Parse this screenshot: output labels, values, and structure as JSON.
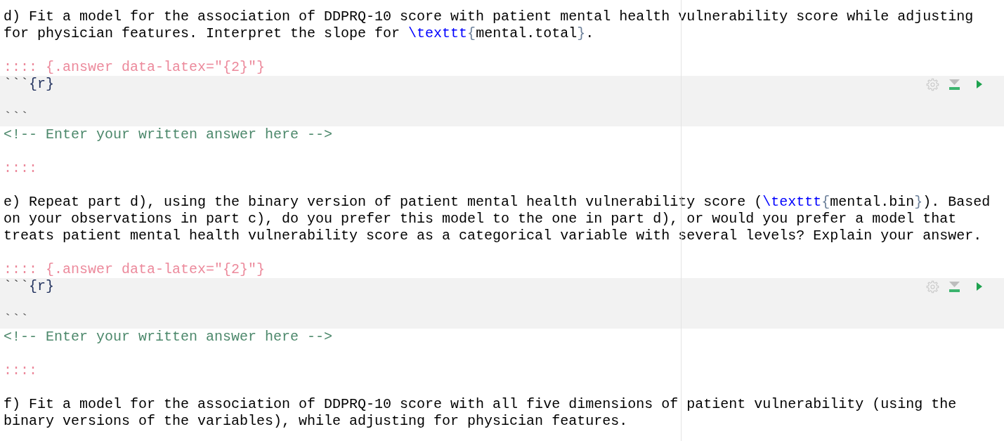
{
  "editor": {
    "blocks": [
      {
        "kind": "question",
        "lines": [
          [
            {
              "kind": "text",
              "text": "d) Fit a model for the association of DDPRQ-10 score with patient mental health vulnerability score while adjusting"
            }
          ],
          [
            {
              "kind": "text",
              "text": "for physician features. Interpret the slope for "
            },
            {
              "kind": "command",
              "text": "\\texttt"
            },
            {
              "kind": "brace",
              "text": "{"
            },
            {
              "kind": "text",
              "text": "mental.total"
            },
            {
              "kind": "brace",
              "text": "}"
            },
            {
              "kind": "text",
              "text": "."
            }
          ]
        ]
      },
      {
        "kind": "answer",
        "open_fence": ":::: {.answer data-latex=\"{2}\"}",
        "chunk": {
          "header": [
            {
              "kind": "backticks",
              "text": "```"
            },
            {
              "kind": "engine",
              "text": "{r}"
            }
          ],
          "close": "```"
        },
        "comment": "<!-- Enter your written answer here -->",
        "close_fence": "::::"
      },
      {
        "kind": "question",
        "lines": [
          [
            {
              "kind": "text",
              "text": "e) Repeat part d), using the binary version of patient mental health vulnerability score ("
            },
            {
              "kind": "command",
              "text": "\\texttt"
            },
            {
              "kind": "brace",
              "text": "{"
            },
            {
              "kind": "text",
              "text": "mental.bin"
            },
            {
              "kind": "brace",
              "text": "}"
            },
            {
              "kind": "text",
              "text": "). Based"
            }
          ],
          [
            {
              "kind": "text",
              "text": "on your observations in part c), do you prefer this model to the one in part d), or would you prefer a model that"
            }
          ],
          [
            {
              "kind": "text",
              "text": "treats patient mental health vulnerability score as a categorical variable with several levels? Explain your answer."
            }
          ]
        ]
      },
      {
        "kind": "answer",
        "open_fence": ":::: {.answer data-latex=\"{2}\"}",
        "chunk": {
          "header": [
            {
              "kind": "backticks",
              "text": "```"
            },
            {
              "kind": "engine",
              "text": "{r}"
            }
          ],
          "close": "```"
        },
        "comment": "<!-- Enter your written answer here -->",
        "close_fence": "::::"
      },
      {
        "kind": "question",
        "lines": [
          [
            {
              "kind": "text",
              "text": "f) Fit a model for the association of DDPRQ-10 score with all five dimensions of patient vulnerability (using the"
            }
          ],
          [
            {
              "kind": "text",
              "text": "binary versions of the variables), while adjusting for physician features."
            }
          ]
        ]
      }
    ]
  }
}
